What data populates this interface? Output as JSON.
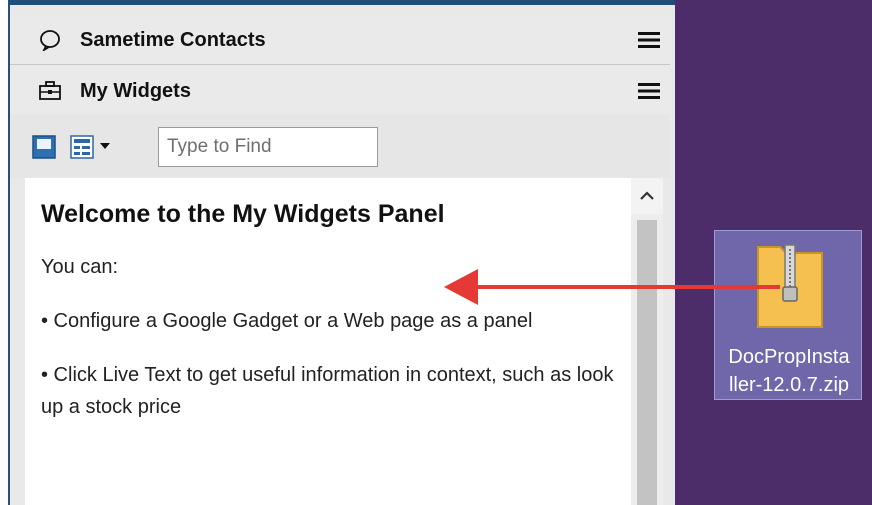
{
  "panels": {
    "sametime": {
      "title": "Sametime Contacts",
      "icon": "chat-bubble-icon"
    },
    "widgets": {
      "title": "My Widgets",
      "icon": "briefcase-icon"
    }
  },
  "toolbar": {
    "search_placeholder": "Type to Find",
    "icons": [
      "panel-view-icon",
      "list-view-icon",
      "dropdown-arrow-icon"
    ]
  },
  "welcome": {
    "heading": "Welcome to the My Widgets Panel",
    "intro": "You can:",
    "bullet1": "• Configure a Google Gadget or a Web page as a panel",
    "bullet2": "• Click Live Text to get useful information in context, such as look up a stock price"
  },
  "desktop": {
    "file_label_line1": "DocPropInsta",
    "file_label_line2": "ller-12.0.7.zip",
    "file_icon": "zip-folder-icon"
  },
  "colors": {
    "accent_blue": "#2f4d7a",
    "desktop_bg": "#4c2c69",
    "arrow_red": "#e53935"
  }
}
